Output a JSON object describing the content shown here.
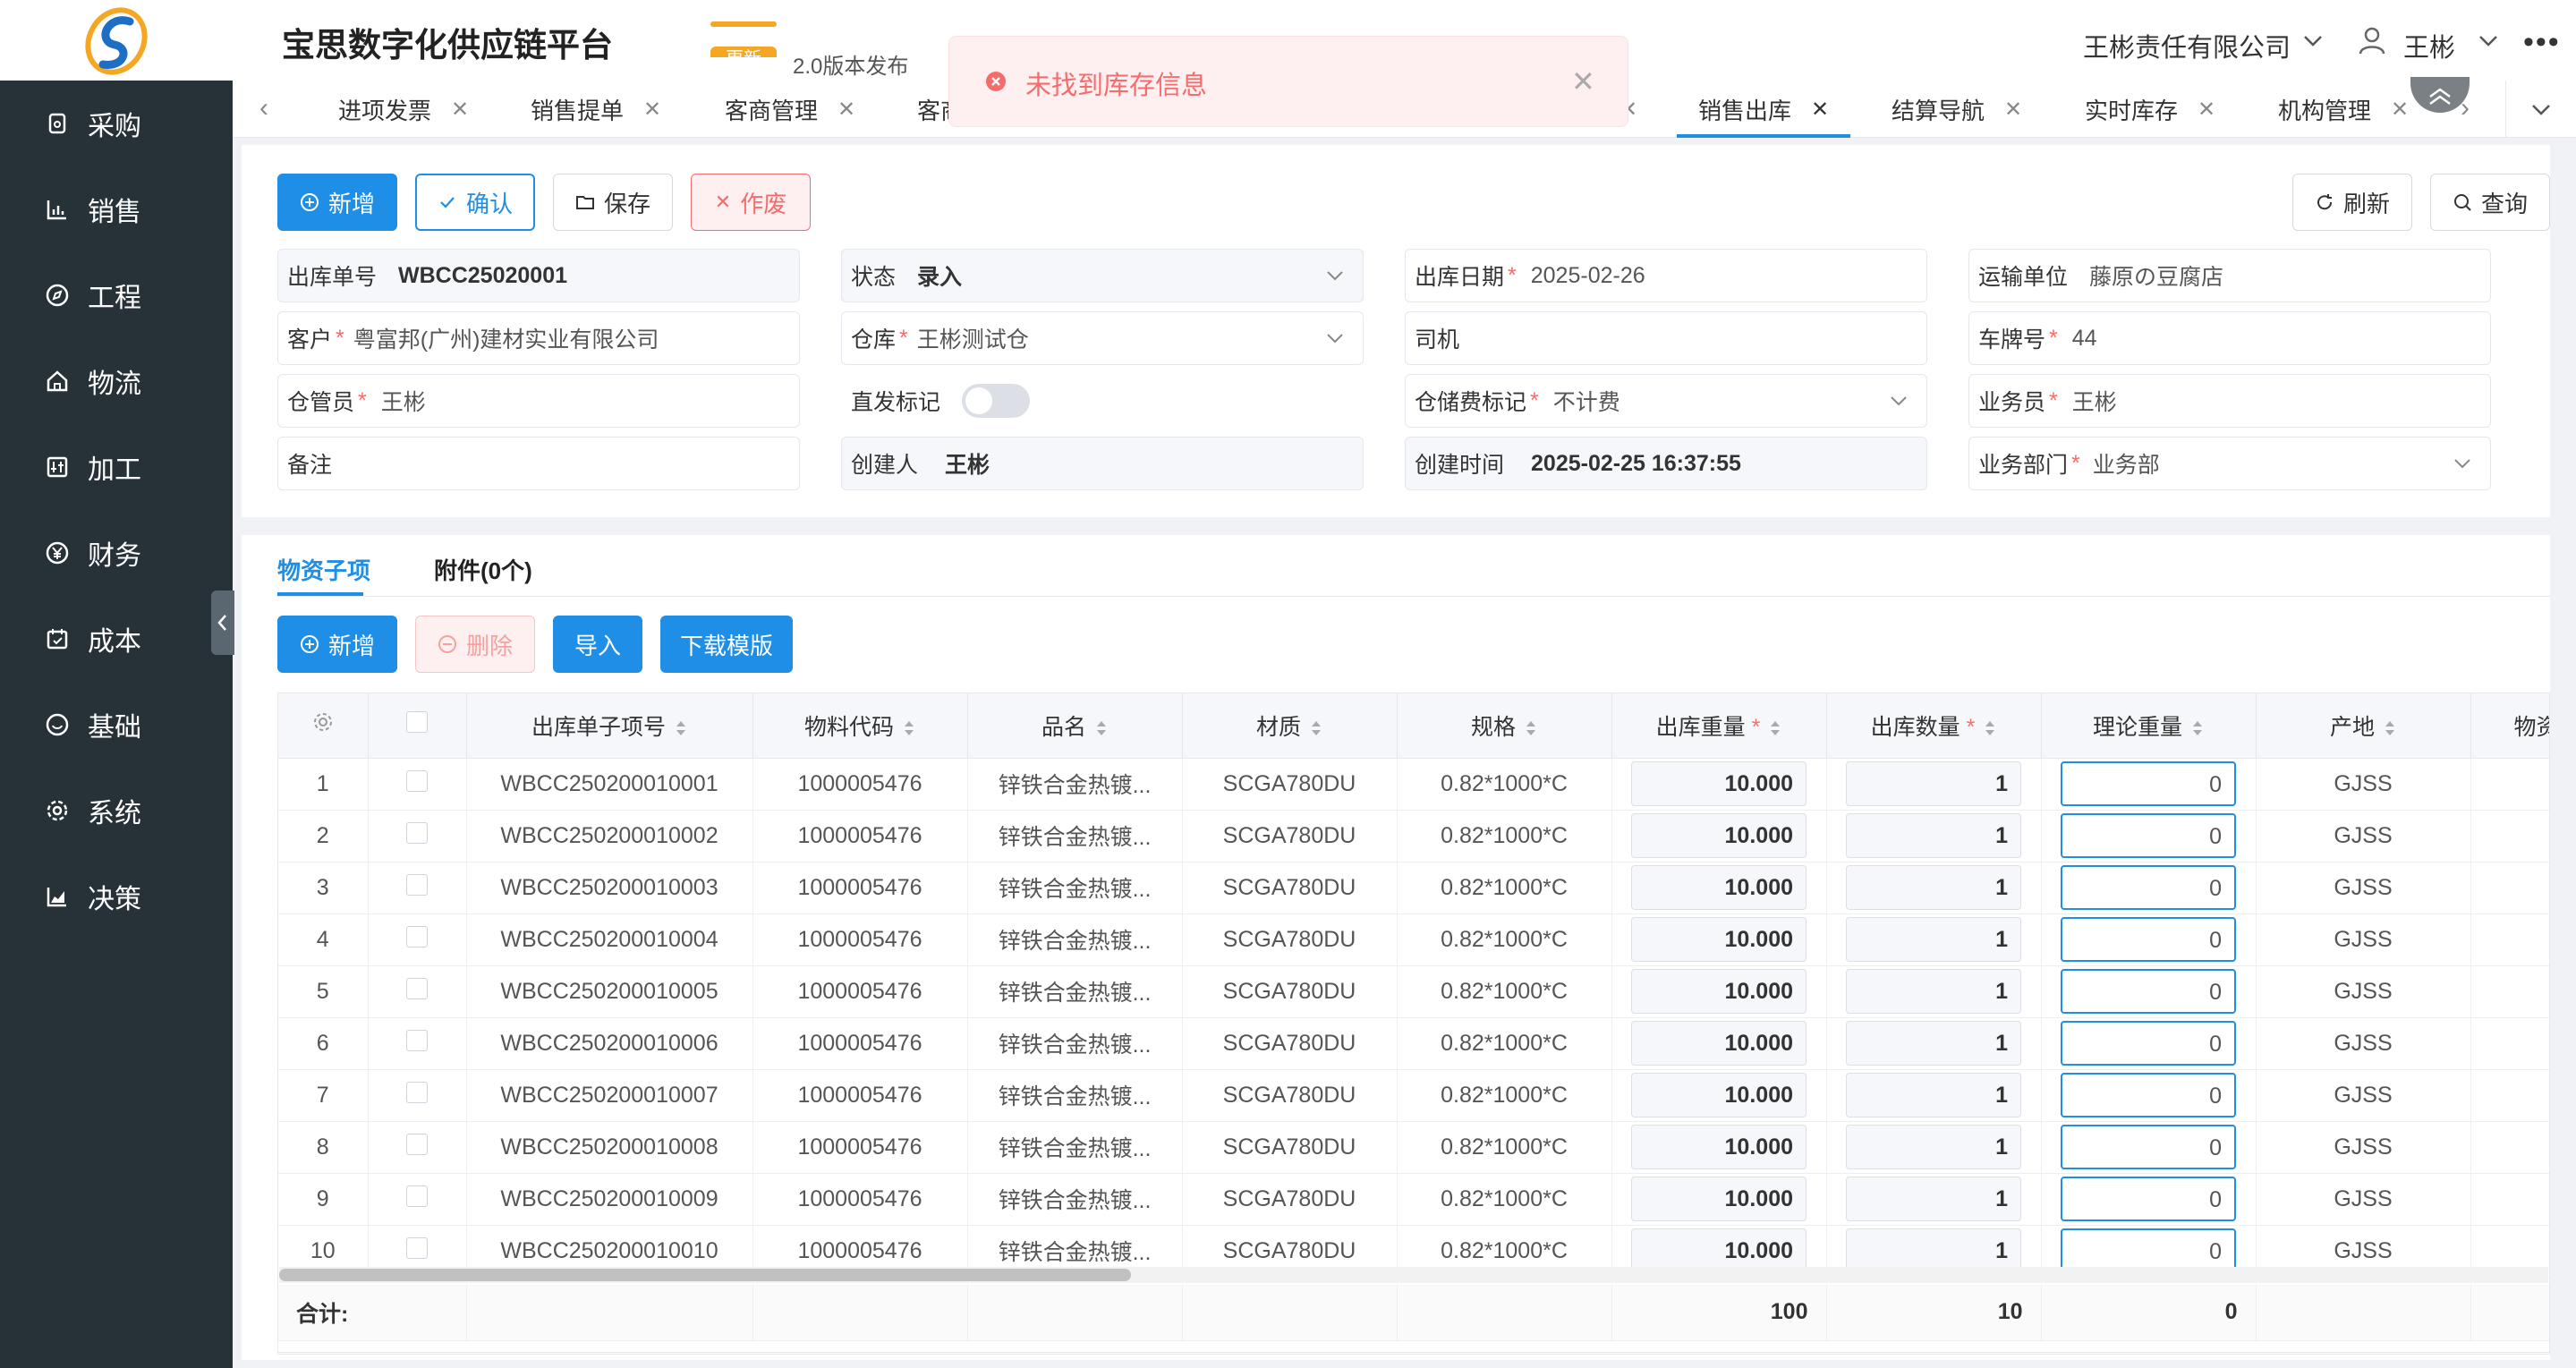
{
  "app": {
    "title": "宝思数字化供应链平台",
    "release_badge": "更新",
    "release_text": "2.0版本发布",
    "company": "王彬责任有限公司",
    "user": "王彬"
  },
  "toast": {
    "message": "未找到库存信息",
    "type": "error"
  },
  "sidebar": {
    "items": [
      {
        "label": "采购",
        "icon": "purchase-icon"
      },
      {
        "label": "销售",
        "icon": "bar-chart-icon"
      },
      {
        "label": "工程",
        "icon": "compass-icon"
      },
      {
        "label": "物流",
        "icon": "home-icon"
      },
      {
        "label": "加工",
        "icon": "process-icon"
      },
      {
        "label": "财务",
        "icon": "yen-icon"
      },
      {
        "label": "成本",
        "icon": "calendar-icon"
      },
      {
        "label": "基础",
        "icon": "smile-icon"
      },
      {
        "label": "系统",
        "icon": "gear-icon"
      },
      {
        "label": "决策",
        "icon": "area-chart-icon"
      }
    ]
  },
  "tabs": [
    {
      "label": "进项发票"
    },
    {
      "label": "销售提单"
    },
    {
      "label": "客商管理"
    },
    {
      "label": "客商"
    },
    {
      "label": "销售出库",
      "active": true
    },
    {
      "label": "结算导航"
    },
    {
      "label": "实时库存"
    },
    {
      "label": "机构管理"
    }
  ],
  "toolbar": {
    "add": "新增",
    "confirm": "确认",
    "save": "保存",
    "void": "作废",
    "refresh": "刷新",
    "query": "查询"
  },
  "form": {
    "order_no": {
      "label": "出库单号",
      "value": "WBCC25020001"
    },
    "status": {
      "label": "状态",
      "value": "录入"
    },
    "out_date": {
      "label": "出库日期",
      "value": "2025-02-26"
    },
    "carrier": {
      "label": "运输单位",
      "value": "藤原の豆腐店"
    },
    "customer": {
      "label": "客户",
      "value": "粤富邦(广州)建材实业有限公司"
    },
    "warehouse": {
      "label": "仓库",
      "value": "王彬测试仓"
    },
    "driver": {
      "label": "司机",
      "value": ""
    },
    "plate": {
      "label": "车牌号",
      "value": "44"
    },
    "keeper": {
      "label": "仓管员",
      "value": "王彬"
    },
    "direct": {
      "label": "直发标记",
      "value": false
    },
    "storage_fee": {
      "label": "仓储费标记",
      "value": "不计费"
    },
    "salesman": {
      "label": "业务员",
      "value": "王彬"
    },
    "remark": {
      "label": "备注",
      "value": ""
    },
    "creator": {
      "label": "创建人",
      "value": "王彬"
    },
    "created_at": {
      "label": "创建时间",
      "value": "2025-02-25 16:37:55"
    },
    "department": {
      "label": "业务部门",
      "value": "业务部"
    }
  },
  "detail": {
    "tab_items": "物资子项",
    "tab_attachments": "附件(0个)",
    "buttons": {
      "add": "新增",
      "delete": "删除",
      "import": "导入",
      "download": "下载模版"
    },
    "columns": [
      "出库单子项号",
      "物料代码",
      "品名",
      "材质",
      "规格",
      "出库重量",
      "出库数量",
      "理论重量",
      "产地",
      "物资"
    ],
    "rows": [
      {
        "no": "1",
        "item_no": "WBCC250200010001",
        "code": "1000005476",
        "name": "锌铁合金热镀...",
        "material": "SCGA780DU",
        "spec": "0.82*1000*C",
        "weight": "10.000",
        "qty": "1",
        "theory": "0",
        "origin": "GJSS"
      },
      {
        "no": "2",
        "item_no": "WBCC250200010002",
        "code": "1000005476",
        "name": "锌铁合金热镀...",
        "material": "SCGA780DU",
        "spec": "0.82*1000*C",
        "weight": "10.000",
        "qty": "1",
        "theory": "0",
        "origin": "GJSS"
      },
      {
        "no": "3",
        "item_no": "WBCC250200010003",
        "code": "1000005476",
        "name": "锌铁合金热镀...",
        "material": "SCGA780DU",
        "spec": "0.82*1000*C",
        "weight": "10.000",
        "qty": "1",
        "theory": "0",
        "origin": "GJSS"
      },
      {
        "no": "4",
        "item_no": "WBCC250200010004",
        "code": "1000005476",
        "name": "锌铁合金热镀...",
        "material": "SCGA780DU",
        "spec": "0.82*1000*C",
        "weight": "10.000",
        "qty": "1",
        "theory": "0",
        "origin": "GJSS"
      },
      {
        "no": "5",
        "item_no": "WBCC250200010005",
        "code": "1000005476",
        "name": "锌铁合金热镀...",
        "material": "SCGA780DU",
        "spec": "0.82*1000*C",
        "weight": "10.000",
        "qty": "1",
        "theory": "0",
        "origin": "GJSS"
      },
      {
        "no": "6",
        "item_no": "WBCC250200010006",
        "code": "1000005476",
        "name": "锌铁合金热镀...",
        "material": "SCGA780DU",
        "spec": "0.82*1000*C",
        "weight": "10.000",
        "qty": "1",
        "theory": "0",
        "origin": "GJSS"
      },
      {
        "no": "7",
        "item_no": "WBCC250200010007",
        "code": "1000005476",
        "name": "锌铁合金热镀...",
        "material": "SCGA780DU",
        "spec": "0.82*1000*C",
        "weight": "10.000",
        "qty": "1",
        "theory": "0",
        "origin": "GJSS"
      },
      {
        "no": "8",
        "item_no": "WBCC250200010008",
        "code": "1000005476",
        "name": "锌铁合金热镀...",
        "material": "SCGA780DU",
        "spec": "0.82*1000*C",
        "weight": "10.000",
        "qty": "1",
        "theory": "0",
        "origin": "GJSS"
      },
      {
        "no": "9",
        "item_no": "WBCC250200010009",
        "code": "1000005476",
        "name": "锌铁合金热镀...",
        "material": "SCGA780DU",
        "spec": "0.82*1000*C",
        "weight": "10.000",
        "qty": "1",
        "theory": "0",
        "origin": "GJSS"
      },
      {
        "no": "10",
        "item_no": "WBCC250200010010",
        "code": "1000005476",
        "name": "锌铁合金热镀...",
        "material": "SCGA780DU",
        "spec": "0.82*1000*C",
        "weight": "10.000",
        "qty": "1",
        "theory": "0",
        "origin": "GJSS"
      }
    ],
    "summary": {
      "label": "合计:",
      "weight": "100",
      "qty": "10",
      "theory": "0"
    }
  },
  "colors": {
    "primary": "#1e8ee6",
    "danger": "#f56c6c",
    "sidebar": "#263238"
  }
}
